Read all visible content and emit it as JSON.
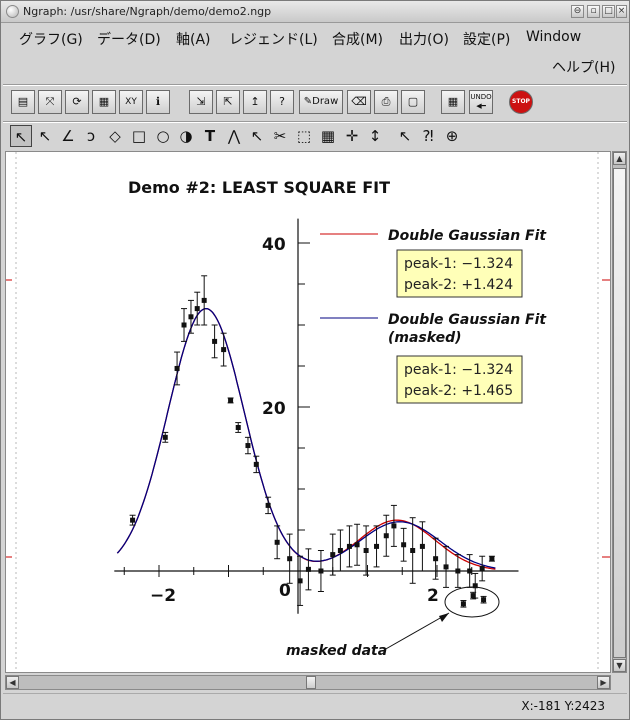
{
  "window": {
    "title": "Ngraph: /usr/share/Ngraph/demo/demo2.ngp"
  },
  "menu": {
    "items": [
      {
        "label": "グラフ(G)"
      },
      {
        "label": "データ(D)"
      },
      {
        "label": "軸(A)"
      },
      {
        "label": "レジェンド(L)"
      },
      {
        "label": "合成(M)"
      },
      {
        "label": "出力(O)"
      },
      {
        "label": "設定(P)"
      },
      {
        "label": "Window"
      },
      {
        "label": "ヘルプ(H)"
      }
    ]
  },
  "toolbar1": {
    "draw_label": "Draw",
    "undo_label": "UNDO",
    "stop_label": "STOP",
    "xy_label": "XY",
    "icons": [
      "file-list-icon",
      "axis-list-icon",
      "merge-list-icon",
      "legend-list-icon",
      "xy-data-icon",
      "info-icon",
      "data-load-icon",
      "data-save-icon",
      "graph-load-icon",
      "math-icon",
      "draw-icon",
      "clear-icon",
      "print-icon",
      "viewer-icon",
      "calculator-icon",
      "undo-icon",
      "stop-icon"
    ]
  },
  "toolbar2": {
    "icons": [
      "pointer-icon",
      "legend-pointer-icon",
      "line-icon",
      "curve-icon",
      "polygon-icon",
      "rectangle-icon",
      "arc-icon",
      "mark-icon",
      "text-icon",
      "gauss-icon",
      "axis-pointer-icon",
      "trimming-icon",
      "frame-graph-icon",
      "section-graph-icon",
      "cross-axis-icon",
      "single-axis-icon",
      "data-pointer-icon",
      "eval-icon",
      "zoom-icon"
    ]
  },
  "chart": {
    "title": "Demo #2: LEAST SQUARE FIT",
    "y_tick_labels": [
      "40",
      "20"
    ],
    "x_tick_labels": [
      "−2",
      "0",
      "2"
    ],
    "legend": {
      "entry1": "Double Gaussian Fit",
      "entry2_line1": "Double Gaussian Fit",
      "entry2_line2": "(masked)",
      "color1": "#cc0000",
      "color2": "#000080"
    },
    "box1": {
      "line1": "peak-1: −1.324",
      "line2": "peak-2: +1.424"
    },
    "box2": {
      "line1": "peak-1: −1.324",
      "line2": "peak-2: +1.465"
    },
    "annotation": "masked data"
  },
  "chart_data": {
    "type": "scatter",
    "title": "Demo #2: LEAST SQUARE FIT",
    "xlim": [
      -2.6,
      3.0
    ],
    "ylim": [
      -4,
      42
    ],
    "x_ticks": [
      -2,
      0,
      2
    ],
    "y_ticks": [
      20,
      40
    ],
    "series": [
      {
        "name": "data",
        "points": [
          [
            -2.38,
            6.2,
            0.6
          ],
          [
            -1.91,
            16.3,
            0.6
          ],
          [
            -1.74,
            24.7,
            2.0
          ],
          [
            -1.64,
            30.0,
            2.0
          ],
          [
            -1.54,
            31.0,
            2.0
          ],
          [
            -1.45,
            32.0,
            2.0
          ],
          [
            -1.35,
            33.0,
            3.0
          ],
          [
            -1.2,
            28.0,
            2.0
          ],
          [
            -1.07,
            27.0,
            2.0
          ],
          [
            -0.97,
            20.8,
            0.3
          ],
          [
            -0.86,
            17.5,
            0.6
          ],
          [
            -0.72,
            15.3,
            1.0
          ],
          [
            -0.6,
            13.0,
            1.0
          ],
          [
            -0.43,
            8.0,
            1.0
          ],
          [
            -0.3,
            3.5,
            2.0
          ],
          [
            -0.12,
            1.5,
            3.0
          ],
          [
            0.03,
            -1.2,
            3.0
          ],
          [
            0.15,
            0.2,
            2.5
          ],
          [
            0.33,
            0.0,
            2.5
          ],
          [
            0.5,
            2.0,
            2.5
          ],
          [
            0.61,
            2.5,
            2.5
          ],
          [
            0.74,
            3.0,
            2.5
          ],
          [
            0.85,
            3.2,
            2.5
          ],
          [
            0.98,
            2.5,
            3.0
          ],
          [
            1.13,
            3.0,
            2.5
          ],
          [
            1.27,
            4.3,
            2.5
          ],
          [
            1.38,
            5.5,
            2.5
          ],
          [
            1.52,
            3.2,
            2.0
          ],
          [
            1.65,
            2.5,
            4.0
          ],
          [
            1.79,
            3.0,
            3.0
          ],
          [
            1.98,
            1.5,
            2.5
          ],
          [
            2.13,
            0.5,
            2.5
          ],
          [
            2.3,
            0.0,
            2.0
          ],
          [
            2.47,
            0.0,
            2.0
          ],
          [
            2.55,
            -1.8,
            1.5
          ],
          [
            2.65,
            0.3,
            1.5
          ],
          [
            2.79,
            1.5,
            0.3
          ]
        ]
      },
      {
        "name": "masked data",
        "points": [
          [
            2.38,
            -4.0,
            0.4
          ],
          [
            2.52,
            -3.0,
            0.4
          ],
          [
            2.67,
            -3.5,
            0.4
          ]
        ]
      }
    ],
    "fit_curves": [
      {
        "name": "Double Gaussian Fit",
        "color": "#cc0000",
        "a1": 32.0,
        "mu1": -1.324,
        "s1": 0.55,
        "a2": 6.2,
        "mu2": 1.424,
        "s2": 0.55
      },
      {
        "name": "Double Gaussian Fit (masked)",
        "color": "#000080",
        "a1": 32.0,
        "mu1": -1.324,
        "s1": 0.55,
        "a2": 6.0,
        "mu2": 1.465,
        "s2": 0.58
      }
    ]
  },
  "status": {
    "coords": "X:-181 Y:2423"
  }
}
